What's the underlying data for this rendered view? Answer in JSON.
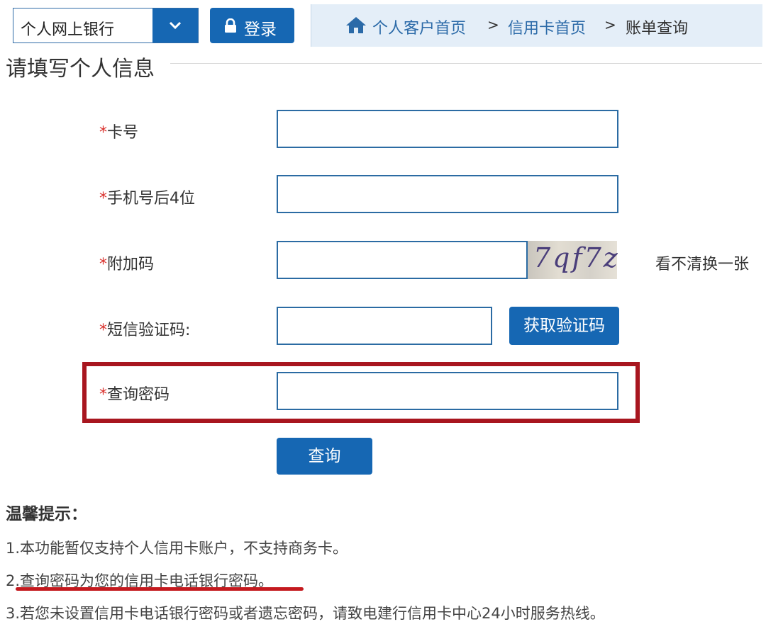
{
  "top_bar": {
    "bank_select_value": "个人网上银行",
    "login_label": "登录",
    "breadcrumb": {
      "home": "个人客户首页",
      "separator": ">",
      "credit_card": "信用卡首页",
      "current": "账单查询"
    }
  },
  "section_title": "请填写个人信息",
  "form": {
    "required_mark": "*",
    "card_number_label": "卡号",
    "card_number_value": "",
    "phone_last4_label": "手机号后4位",
    "phone_last4_value": "",
    "captcha_label": "附加码",
    "captcha_value": "",
    "captcha_image_text": "7qf7z",
    "refresh_captcha": "看不清换一张",
    "sms_label": "短信验证码:",
    "sms_value": "",
    "get_sms_button": "获取验证码",
    "query_password_label": "查询密码",
    "query_password_value": "",
    "submit_button": "查询"
  },
  "tips": {
    "title": "温馨提示：",
    "items": [
      "1.本功能暂仅支持个人信用卡账户，不支持商务卡。",
      "2.查询密码为您的信用卡电话银行密码。",
      "3.若您未设置信用卡电话银行密码或者遗忘密码，请致电建行信用卡中心24小时服务热线。"
    ]
  },
  "colors": {
    "primary_blue": "#1667b3",
    "breadcrumb_bg": "#e4eef8",
    "highlight_red": "#a8161f",
    "required_red": "#d9302c"
  }
}
